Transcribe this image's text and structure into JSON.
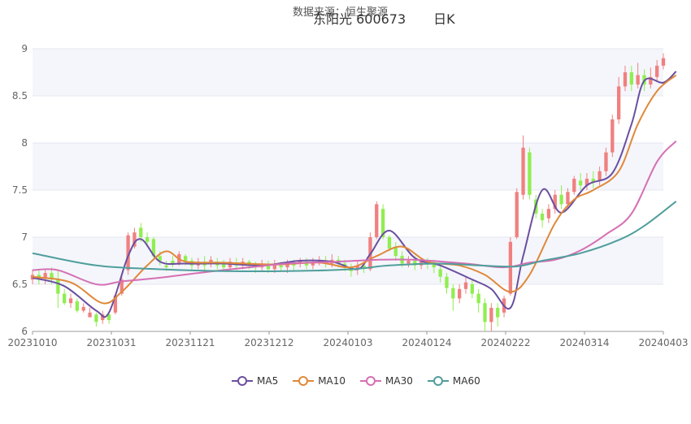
{
  "header": {
    "source": "数据来源：恒生聚源",
    "stock": "东阳光 600673",
    "period": "日K"
  },
  "chart_data": {
    "type": "candlestick",
    "title": "东阳光 600673 日K",
    "ylim": [
      6,
      9
    ],
    "yticks": [
      "9",
      "8.5",
      "8",
      "7.5",
      "7",
      "6.5",
      "6"
    ],
    "xticks": [
      "20231010",
      "20231031",
      "20231121",
      "20231212",
      "20240103",
      "20240124",
      "20240222",
      "20240314",
      "20240403"
    ],
    "grid": true,
    "legend_position": "bottom",
    "colors": {
      "up": "#f08080",
      "down": "#90ee50"
    },
    "candles": [
      [
        6.55,
        6.6,
        6.5,
        6.66
      ],
      [
        6.6,
        6.55,
        6.5,
        6.65
      ],
      [
        6.57,
        6.62,
        6.5,
        6.66
      ],
      [
        6.62,
        6.55,
        6.5,
        6.68
      ],
      [
        6.55,
        6.4,
        6.25,
        6.65
      ],
      [
        6.4,
        6.3,
        6.28,
        6.45
      ],
      [
        6.3,
        6.35,
        6.25,
        6.4
      ],
      [
        6.32,
        6.22,
        6.2,
        6.35
      ],
      [
        6.22,
        6.26,
        6.2,
        6.3
      ],
      [
        6.15,
        6.2,
        6.15,
        6.25
      ],
      [
        6.18,
        6.1,
        6.05,
        6.2
      ],
      [
        6.12,
        6.18,
        6.08,
        6.22
      ],
      [
        6.18,
        6.12,
        6.08,
        6.2
      ],
      [
        6.2,
        6.38,
        6.18,
        6.4
      ],
      [
        6.4,
        6.55,
        6.38,
        6.6
      ],
      [
        6.65,
        7.02,
        6.6,
        7.05
      ],
      [
        6.9,
        7.05,
        6.88,
        7.1
      ],
      [
        7.1,
        7.0,
        6.95,
        7.15
      ],
      [
        7.0,
        6.95,
        6.9,
        7.05
      ],
      [
        6.98,
        6.8,
        6.78,
        7.0
      ],
      [
        6.8,
        6.75,
        6.7,
        6.85
      ],
      [
        6.7,
        6.68,
        6.64,
        6.75
      ],
      [
        6.75,
        6.72,
        6.68,
        6.8
      ],
      [
        6.72,
        6.82,
        6.7,
        6.85
      ],
      [
        6.8,
        6.75,
        6.7,
        6.82
      ],
      [
        6.75,
        6.7,
        6.65,
        6.78
      ],
      [
        6.7,
        6.74,
        6.66,
        6.78
      ],
      [
        6.74,
        6.7,
        6.65,
        6.8
      ],
      [
        6.72,
        6.76,
        6.68,
        6.8
      ],
      [
        6.74,
        6.7,
        6.66,
        6.78
      ],
      [
        6.72,
        6.68,
        6.64,
        6.76
      ],
      [
        6.68,
        6.74,
        6.65,
        6.78
      ],
      [
        6.72,
        6.7,
        6.65,
        6.78
      ],
      [
        6.7,
        6.74,
        6.66,
        6.78
      ],
      [
        6.74,
        6.7,
        6.66,
        6.76
      ],
      [
        6.7,
        6.68,
        6.62,
        6.74
      ],
      [
        6.68,
        6.72,
        6.64,
        6.76
      ],
      [
        6.7,
        6.66,
        6.62,
        6.75
      ],
      [
        6.66,
        6.72,
        6.62,
        6.76
      ],
      [
        6.7,
        6.68,
        6.64,
        6.74
      ],
      [
        6.68,
        6.72,
        6.62,
        6.76
      ],
      [
        6.72,
        6.7,
        6.65,
        6.76
      ],
      [
        6.72,
        6.75,
        6.68,
        6.78
      ],
      [
        6.74,
        6.7,
        6.66,
        6.78
      ],
      [
        6.7,
        6.74,
        6.66,
        6.78
      ],
      [
        6.74,
        6.76,
        6.7,
        6.8
      ],
      [
        6.75,
        6.72,
        6.68,
        6.8
      ],
      [
        6.72,
        6.76,
        6.68,
        6.82
      ],
      [
        6.76,
        6.72,
        6.68,
        6.8
      ],
      [
        6.72,
        6.68,
        6.64,
        6.76
      ],
      [
        6.68,
        6.64,
        6.58,
        6.72
      ],
      [
        6.66,
        6.7,
        6.6,
        6.74
      ],
      [
        6.7,
        6.68,
        6.62,
        6.74
      ],
      [
        6.66,
        7.0,
        6.64,
        7.05
      ],
      [
        7.0,
        7.35,
        6.98,
        7.38
      ],
      [
        7.3,
        7.0,
        6.98,
        7.35
      ],
      [
        7.0,
        6.88,
        6.85,
        7.02
      ],
      [
        6.9,
        6.8,
        6.75,
        6.95
      ],
      [
        6.8,
        6.72,
        6.68,
        6.85
      ],
      [
        6.72,
        6.75,
        6.68,
        6.8
      ],
      [
        6.75,
        6.7,
        6.65,
        6.8
      ],
      [
        6.7,
        6.74,
        6.66,
        6.78
      ],
      [
        6.74,
        6.72,
        6.66,
        6.78
      ],
      [
        6.72,
        6.68,
        6.62,
        6.76
      ],
      [
        6.66,
        6.58,
        6.52,
        6.7
      ],
      [
        6.58,
        6.46,
        6.4,
        6.62
      ],
      [
        6.46,
        6.35,
        6.22,
        6.5
      ],
      [
        6.35,
        6.45,
        6.3,
        6.5
      ],
      [
        6.45,
        6.52,
        6.4,
        6.58
      ],
      [
        6.5,
        6.4,
        6.35,
        6.55
      ],
      [
        6.4,
        6.3,
        6.2,
        6.45
      ],
      [
        6.3,
        6.1,
        6.0,
        6.35
      ],
      [
        6.1,
        6.25,
        6.0,
        6.3
      ],
      [
        6.25,
        6.15,
        6.05,
        6.3
      ],
      [
        6.2,
        6.35,
        6.15,
        6.38
      ],
      [
        6.4,
        6.95,
        6.38,
        7.0
      ],
      [
        7.0,
        7.48,
        6.98,
        7.52
      ],
      [
        7.45,
        7.95,
        7.4,
        8.08
      ],
      [
        7.9,
        7.45,
        7.4,
        7.95
      ],
      [
        7.4,
        7.25,
        7.2,
        7.45
      ],
      [
        7.25,
        7.18,
        7.1,
        7.3
      ],
      [
        7.2,
        7.3,
        7.15,
        7.35
      ],
      [
        7.3,
        7.45,
        7.25,
        7.5
      ],
      [
        7.45,
        7.35,
        7.3,
        7.55
      ],
      [
        7.35,
        7.48,
        7.3,
        7.52
      ],
      [
        7.48,
        7.62,
        7.45,
        7.65
      ],
      [
        7.6,
        7.55,
        7.5,
        7.68
      ],
      [
        7.55,
        7.62,
        7.5,
        7.68
      ],
      [
        7.62,
        7.58,
        7.52,
        7.7
      ],
      [
        7.6,
        7.7,
        7.55,
        7.75
      ],
      [
        7.7,
        7.9,
        7.65,
        7.95
      ],
      [
        7.9,
        8.25,
        7.85,
        8.3
      ],
      [
        8.25,
        8.6,
        8.2,
        8.7
      ],
      [
        8.6,
        8.75,
        8.55,
        8.82
      ],
      [
        8.75,
        8.62,
        8.55,
        8.82
      ],
      [
        8.62,
        8.72,
        8.58,
        8.85
      ],
      [
        8.72,
        8.62,
        8.55,
        8.78
      ],
      [
        8.62,
        8.7,
        8.58,
        8.8
      ],
      [
        8.7,
        8.82,
        8.65,
        8.88
      ],
      [
        8.82,
        8.9,
        8.78,
        8.95
      ]
    ],
    "series": [
      {
        "name": "MA5",
        "color": "#6a4fa0",
        "points": [
          [
            0,
            6.57
          ],
          [
            5,
            6.48
          ],
          [
            10,
            6.22
          ],
          [
            12,
            6.2
          ],
          [
            15,
            6.8
          ],
          [
            17,
            6.98
          ],
          [
            20,
            6.74
          ],
          [
            24,
            6.72
          ],
          [
            30,
            6.72
          ],
          [
            36,
            6.7
          ],
          [
            42,
            6.75
          ],
          [
            47,
            6.74
          ],
          [
            51,
            6.66
          ],
          [
            53,
            6.82
          ],
          [
            56,
            7.07
          ],
          [
            60,
            6.78
          ],
          [
            64,
            6.7
          ],
          [
            69,
            6.55
          ],
          [
            72,
            6.45
          ],
          [
            75,
            6.25
          ],
          [
            77,
            6.8
          ],
          [
            80,
            7.5
          ],
          [
            83,
            7.26
          ],
          [
            87,
            7.55
          ],
          [
            91,
            7.68
          ],
          [
            94,
            8.2
          ],
          [
            96,
            8.66
          ],
          [
            99,
            8.64
          ],
          [
            101,
            8.76
          ]
        ]
      },
      {
        "name": "MA10",
        "color": "#e0883a",
        "points": [
          [
            0,
            6.58
          ],
          [
            6,
            6.52
          ],
          [
            11,
            6.3
          ],
          [
            14,
            6.42
          ],
          [
            18,
            6.7
          ],
          [
            21,
            6.85
          ],
          [
            24,
            6.74
          ],
          [
            30,
            6.73
          ],
          [
            38,
            6.71
          ],
          [
            45,
            6.73
          ],
          [
            50,
            6.68
          ],
          [
            54,
            6.8
          ],
          [
            58,
            6.9
          ],
          [
            62,
            6.74
          ],
          [
            67,
            6.7
          ],
          [
            71,
            6.6
          ],
          [
            75,
            6.42
          ],
          [
            78,
            6.6
          ],
          [
            82,
            7.15
          ],
          [
            85,
            7.4
          ],
          [
            88,
            7.5
          ],
          [
            92,
            7.7
          ],
          [
            95,
            8.2
          ],
          [
            98,
            8.55
          ],
          [
            101,
            8.72
          ]
        ]
      },
      {
        "name": "MA30",
        "color": "#d66fb4",
        "points": [
          [
            0,
            6.65
          ],
          [
            4,
            6.65
          ],
          [
            10,
            6.5
          ],
          [
            14,
            6.53
          ],
          [
            20,
            6.57
          ],
          [
            26,
            6.62
          ],
          [
            34,
            6.68
          ],
          [
            40,
            6.72
          ],
          [
            48,
            6.74
          ],
          [
            54,
            6.76
          ],
          [
            60,
            6.76
          ],
          [
            68,
            6.72
          ],
          [
            74,
            6.68
          ],
          [
            78,
            6.73
          ],
          [
            82,
            6.76
          ],
          [
            86,
            6.86
          ],
          [
            90,
            7.03
          ],
          [
            94,
            7.25
          ],
          [
            98,
            7.8
          ],
          [
            101,
            8.02
          ]
        ]
      },
      {
        "name": "MA60",
        "color": "#4f9e9c",
        "points": [
          [
            0,
            6.83
          ],
          [
            10,
            6.7
          ],
          [
            20,
            6.66
          ],
          [
            30,
            6.64
          ],
          [
            40,
            6.64
          ],
          [
            50,
            6.66
          ],
          [
            56,
            6.7
          ],
          [
            64,
            6.72
          ],
          [
            70,
            6.7
          ],
          [
            76,
            6.69
          ],
          [
            80,
            6.75
          ],
          [
            86,
            6.83
          ],
          [
            92,
            6.97
          ],
          [
            96,
            7.12
          ],
          [
            101,
            7.38
          ]
        ]
      }
    ]
  }
}
